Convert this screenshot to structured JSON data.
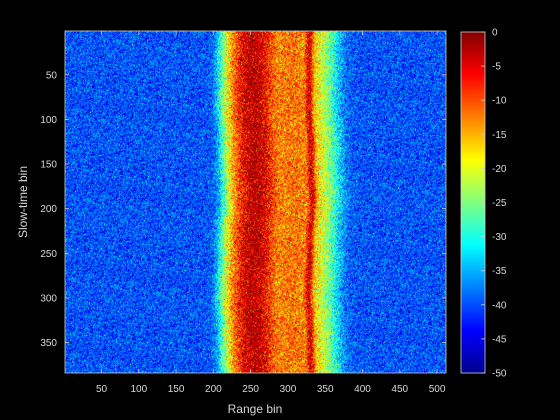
{
  "chart_data": {
    "type": "heatmap",
    "title": "",
    "xlabel": "Range bin",
    "ylabel": "Slow-time bin",
    "xlim": [
      1,
      512
    ],
    "ylim": [
      1,
      384
    ],
    "y_reversed": true,
    "xticks": [
      50,
      100,
      150,
      200,
      250,
      300,
      350,
      400,
      450,
      500
    ],
    "yticks": [
      50,
      100,
      150,
      200,
      250,
      300,
      350
    ],
    "colormap": "jet",
    "clim": [
      -50,
      0
    ],
    "colorbar_ticks": [
      0,
      -5,
      -10,
      -15,
      -20,
      -25,
      -30,
      -35,
      -40,
      -45,
      -50
    ],
    "noise_floor_db": -40,
    "bands": [
      {
        "center_range_bin": 255,
        "width_bins": 30,
        "peak_db": -3
      },
      {
        "center_range_bin": 308,
        "width_bins": 45,
        "peak_db": -12
      },
      {
        "center_range_bin": 330,
        "width_bins": 6,
        "peak_db": -5
      }
    ],
    "band_extent_range_bins": [
      210,
      345
    ]
  }
}
